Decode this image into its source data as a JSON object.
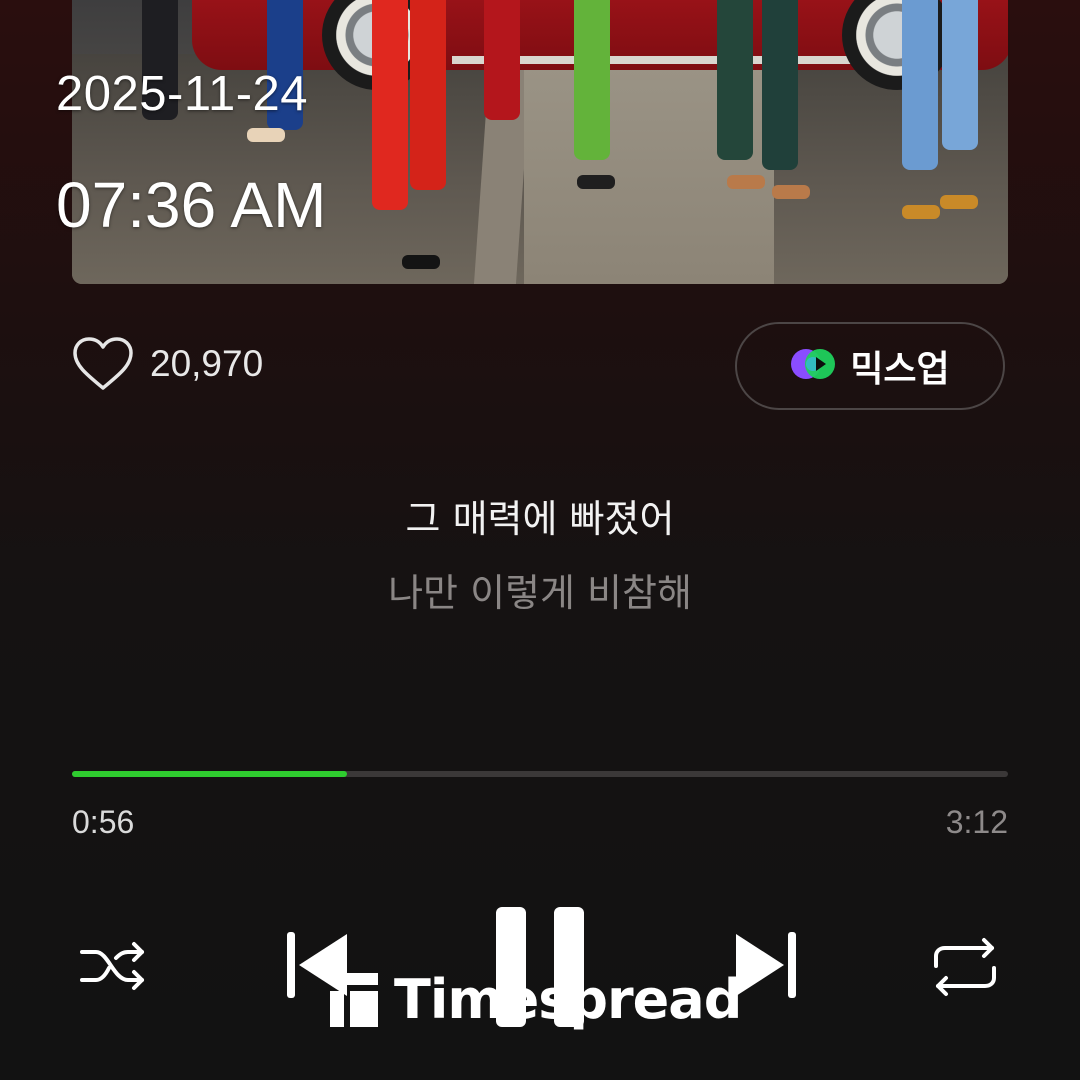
{
  "status": {
    "date": "2025-11-24",
    "time": "07:36 AM"
  },
  "track": {
    "likes": "20,970",
    "mixup_label": "믹스업"
  },
  "lyrics": {
    "current": "그 매력에 빠졌어",
    "next": "나만 이렇게 비참해"
  },
  "progress": {
    "elapsed": "0:56",
    "duration": "3:12",
    "fraction": 0.294
  },
  "controls": {
    "shuffle_icon": "shuffle-icon",
    "previous_icon": "skip-previous-icon",
    "play_state_icon": "pause-icon",
    "next_icon": "skip-next-icon",
    "repeat_icon": "repeat-icon"
  },
  "watermark": {
    "text": "Timespread"
  },
  "colors": {
    "accent": "#2fcc2f",
    "background": "#121212"
  }
}
